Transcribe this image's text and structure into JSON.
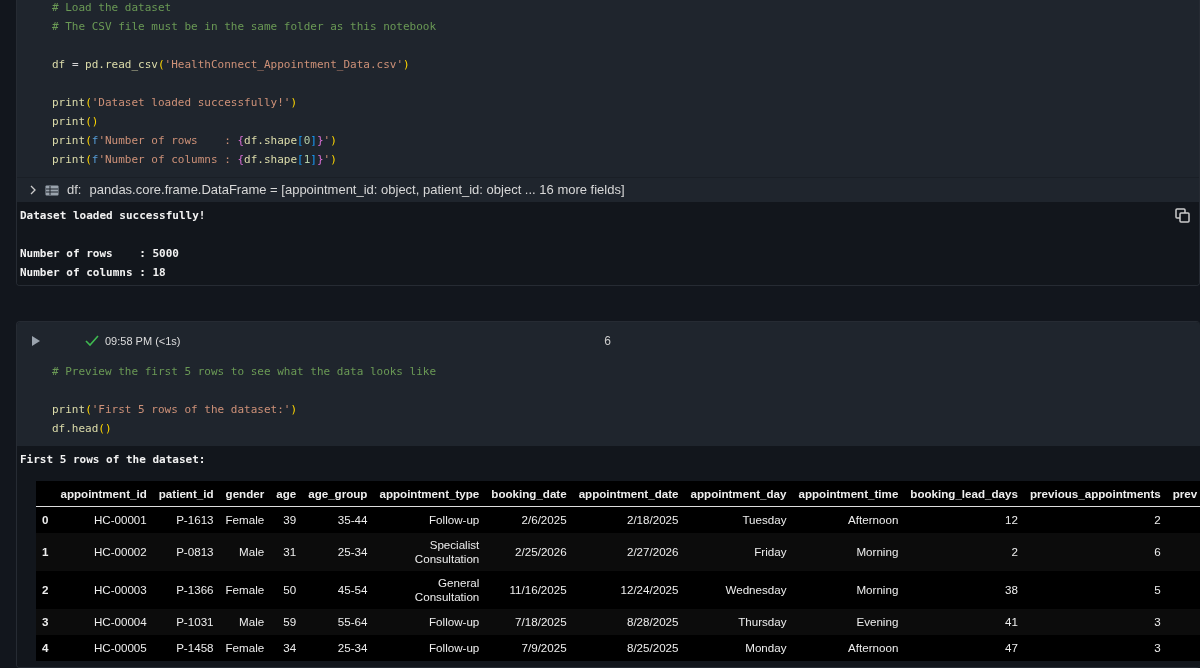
{
  "cells": [
    {
      "kind": "code",
      "code": [
        {
          "kind": "code",
          "tokens": [
            {
              "t": "# Load the dataset",
              "kind": "comment"
            }
          ]
        },
        {
          "kind": "code",
          "tokens": [
            {
              "t": "# The CSV file must be in the same folder as this notebook",
              "kind": "comment"
            }
          ]
        },
        {
          "kind": "blank"
        },
        {
          "kind": "code",
          "tokens": [
            {
              "t": "df ",
              "kind": "name"
            },
            {
              "t": "=",
              "kind": "op"
            },
            {
              "t": " pd.read_csv",
              "kind": "name"
            },
            {
              "t": "(",
              "kind": "paren"
            },
            {
              "t": "'HealthConnect_Appointment_Data.csv'",
              "kind": "string"
            },
            {
              "t": ")",
              "kind": "paren"
            }
          ]
        },
        {
          "kind": "blank"
        },
        {
          "kind": "code",
          "tokens": [
            {
              "t": "print",
              "kind": "name"
            },
            {
              "t": "(",
              "kind": "paren"
            },
            {
              "t": "'Dataset loaded successfully!'",
              "kind": "string"
            },
            {
              "t": ")",
              "kind": "paren"
            }
          ]
        },
        {
          "kind": "code",
          "tokens": [
            {
              "t": "print",
              "kind": "name"
            },
            {
              "t": "()",
              "kind": "paren"
            }
          ]
        },
        {
          "kind": "code",
          "tokens": [
            {
              "t": "print",
              "kind": "name"
            },
            {
              "t": "(",
              "kind": "paren"
            },
            {
              "t": "f",
              "kind": "keyword"
            },
            {
              "t": "'Number of rows    : ",
              "kind": "string"
            },
            {
              "t": "{",
              "kind": "brace"
            },
            {
              "t": "df.shape",
              "kind": "name"
            },
            {
              "t": "[",
              "kind": "bracket"
            },
            {
              "t": "0",
              "kind": "number"
            },
            {
              "t": "]",
              "kind": "bracket"
            },
            {
              "t": "}",
              "kind": "brace"
            },
            {
              "t": "'",
              "kind": "string"
            },
            {
              "t": ")",
              "kind": "paren"
            }
          ]
        },
        {
          "kind": "code",
          "tokens": [
            {
              "t": "print",
              "kind": "name"
            },
            {
              "t": "(",
              "kind": "paren"
            },
            {
              "t": "f",
              "kind": "keyword"
            },
            {
              "t": "'Number of columns : ",
              "kind": "string"
            },
            {
              "t": "{",
              "kind": "brace"
            },
            {
              "t": "df.shape",
              "kind": "name"
            },
            {
              "t": "[",
              "kind": "bracket"
            },
            {
              "t": "1",
              "kind": "number"
            },
            {
              "t": "]",
              "kind": "bracket"
            },
            {
              "t": "}",
              "kind": "brace"
            },
            {
              "t": "'",
              "kind": "string"
            },
            {
              "t": ")",
              "kind": "paren"
            }
          ]
        }
      ],
      "variable": {
        "name": "df:",
        "value": "pandas.core.frame.DataFrame = [appointment_id: object, patient_id: object ... 16 more fields]",
        "expanded": false
      },
      "output": [
        {
          "kind": "text",
          "text": "Dataset loaded successfully!"
        },
        {
          "kind": "blank"
        },
        {
          "kind": "text",
          "text": "Number of rows    : 5000"
        },
        {
          "kind": "text",
          "text": "Number of columns : 18"
        }
      ]
    },
    {
      "kind": "code",
      "header": {
        "succeeded": true,
        "time": "09:58 PM (<1s)",
        "number": "6"
      },
      "code": [
        {
          "kind": "code",
          "tokens": [
            {
              "t": "# Preview the first 5 rows to see what the data looks like",
              "kind": "comment"
            }
          ]
        },
        {
          "kind": "blank"
        },
        {
          "kind": "code",
          "tokens": [
            {
              "t": "print",
              "kind": "name"
            },
            {
              "t": "(",
              "kind": "paren"
            },
            {
              "t": "'First 5 rows of the dataset:'",
              "kind": "string"
            },
            {
              "t": ")",
              "kind": "paren"
            }
          ]
        },
        {
          "kind": "code",
          "tokens": [
            {
              "t": "df.head",
              "kind": "name"
            },
            {
              "t": "()",
              "kind": "paren"
            }
          ]
        }
      ],
      "output": [
        {
          "kind": "text",
          "text": "First 5 rows of the dataset:"
        }
      ],
      "table": {
        "columns": [
          "",
          "appointment_id",
          "patient_id",
          "gender",
          "age",
          "age_group",
          "appointment_type",
          "booking_date",
          "appointment_date",
          "appointment_day",
          "appointment_time",
          "booking_lead_days",
          "previous_appointments",
          "prev"
        ],
        "rows": [
          [
            "0",
            "HC-00001",
            "P-1613",
            "Female",
            "39",
            "35-44",
            "Follow-up",
            "2/6/2025",
            "2/18/2025",
            "Tuesday",
            "Afternoon",
            "12",
            "2"
          ],
          [
            "1",
            "HC-00002",
            "P-0813",
            "Male",
            "31",
            "25-34",
            "Specialist Consultation",
            "2/25/2026",
            "2/27/2026",
            "Friday",
            "Morning",
            "2",
            "6"
          ],
          [
            "2",
            "HC-00003",
            "P-1366",
            "Female",
            "50",
            "45-54",
            "General Consultation",
            "11/16/2025",
            "12/24/2025",
            "Wednesday",
            "Morning",
            "38",
            "5"
          ],
          [
            "3",
            "HC-00004",
            "P-1031",
            "Male",
            "59",
            "55-64",
            "Follow-up",
            "7/18/2025",
            "8/28/2025",
            "Thursday",
            "Evening",
            "41",
            "3"
          ],
          [
            "4",
            "HC-00005",
            "P-1458",
            "Female",
            "34",
            "25-34",
            "Follow-up",
            "7/9/2025",
            "8/25/2025",
            "Monday",
            "Afternoon",
            "47",
            "3"
          ]
        ]
      }
    }
  ]
}
